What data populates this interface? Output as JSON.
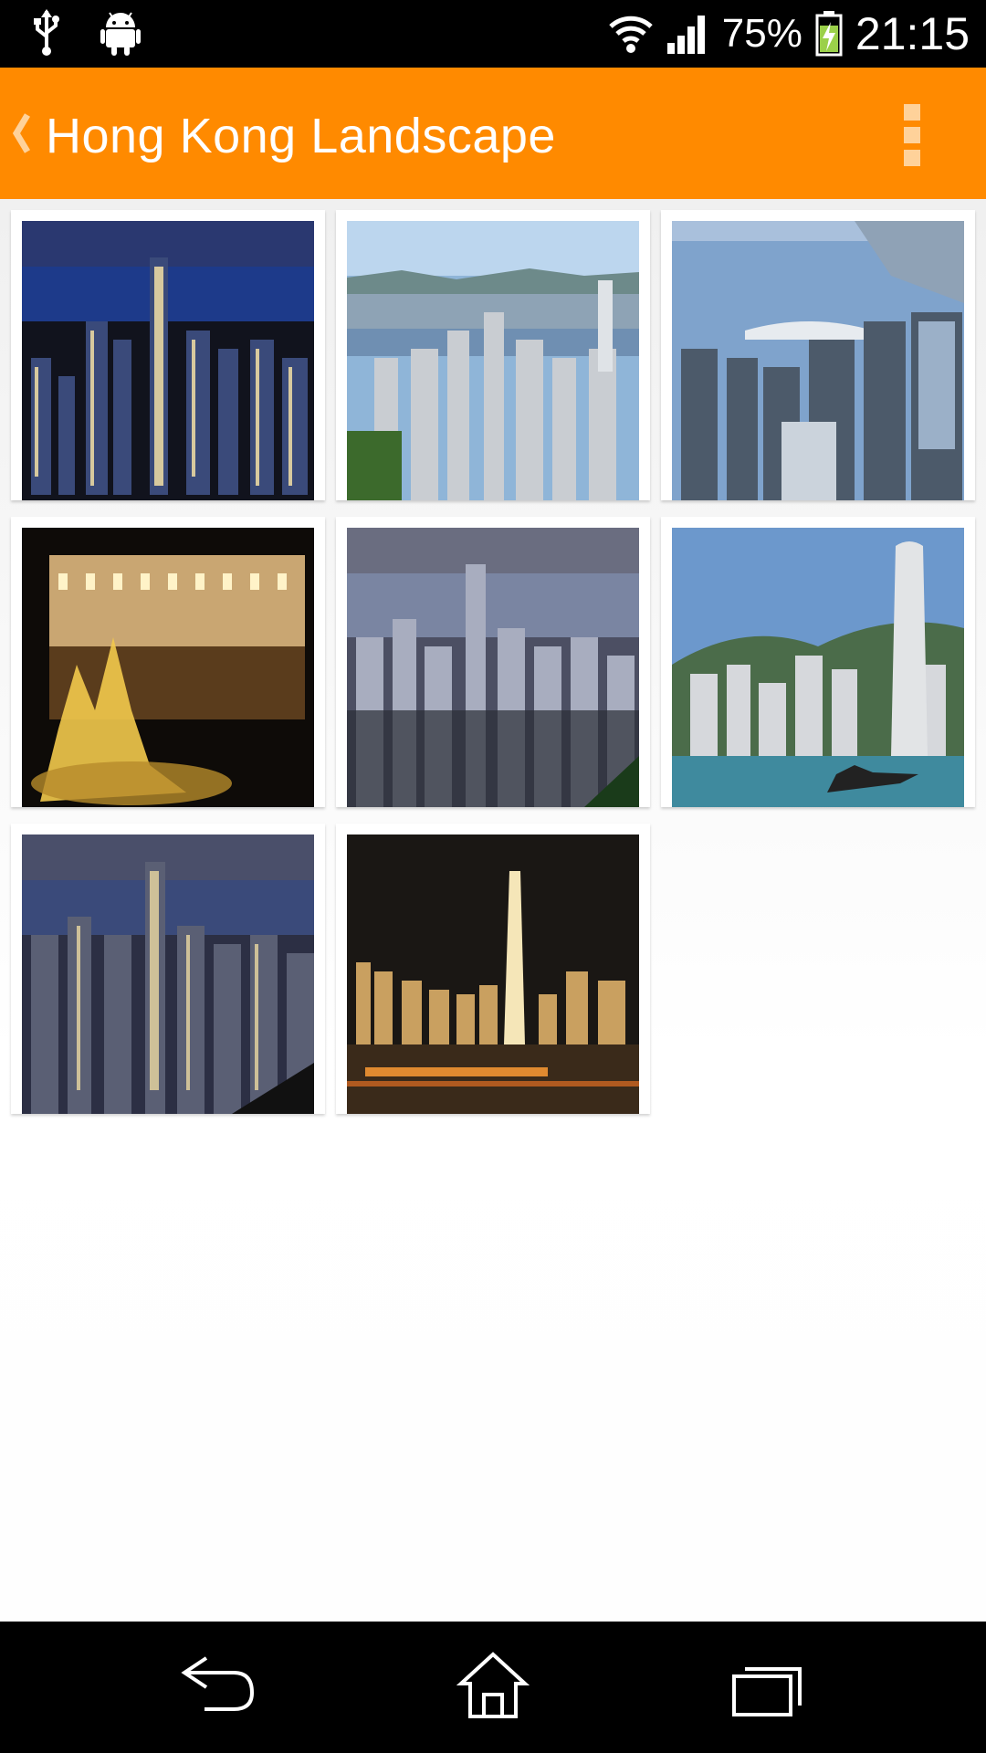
{
  "status_bar": {
    "battery_percent": "75%",
    "time": "21:15",
    "icons": [
      "usb-icon",
      "android-icon",
      "wifi-icon",
      "signal-icon",
      "battery-charging-icon"
    ]
  },
  "action_bar": {
    "title": "Hong Kong Landscape",
    "background_color": "#ff8a00",
    "icons": [
      "back-chevron-icon",
      "overflow-menu-icon"
    ]
  },
  "gallery": {
    "images": [
      "Hong Kong night skyline from the Peak",
      "Hong Kong daytime skyline and harbour",
      "Harbour view with convention centre",
      "Illuminated fountain in front of hotel at night",
      "Hong Kong skyline at dusk from the Peak",
      "Skyline across harbour with patrol boat",
      "Hong Kong night skyline from the Peak (alt)",
      "IFC tower and harbour at night"
    ]
  },
  "nav_bar": {
    "icons": [
      "back-icon",
      "home-icon",
      "recent-apps-icon"
    ]
  }
}
